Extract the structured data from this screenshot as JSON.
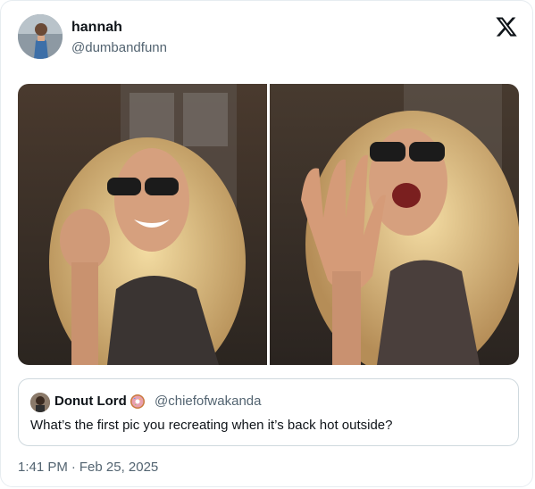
{
  "author": {
    "display_name": "hannah",
    "handle": "@dumbandfunn"
  },
  "quoted_tweet": {
    "display_name": "Donut Lord",
    "handle": "@chiefofwakanda",
    "text": "What’s the first pic you recreating when it’s back hot outside?"
  },
  "meta": {
    "time": "1:41 PM",
    "separator": "·",
    "date": "Feb 25, 2025"
  },
  "icons": {
    "brand": "x-logo-icon",
    "emoji": "donut-emoji-icon"
  },
  "colors": {
    "text": "#0f1419",
    "secondary_text": "#536471",
    "border": "#cfd9de"
  }
}
